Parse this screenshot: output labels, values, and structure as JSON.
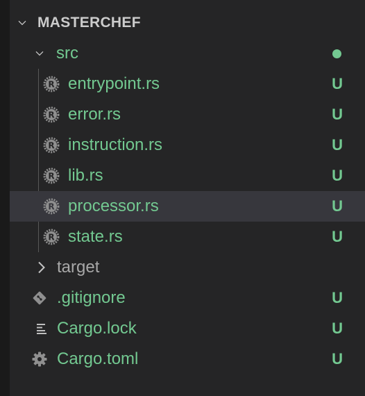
{
  "explorer": {
    "root": {
      "label": "MASTERCHEF",
      "icon": "chevron-down-icon"
    },
    "src_folder": {
      "label": "src",
      "icon": "chevron-down-icon",
      "status_indicator": "modified-dot",
      "status_color": "#73c991"
    },
    "src_files": [
      {
        "label": "entrypoint.rs",
        "status": "U",
        "icon": "rust-icon"
      },
      {
        "label": "error.rs",
        "status": "U",
        "icon": "rust-icon"
      },
      {
        "label": "instruction.rs",
        "status": "U",
        "icon": "rust-icon"
      },
      {
        "label": "lib.rs",
        "status": "U",
        "icon": "rust-icon"
      },
      {
        "label": "processor.rs",
        "status": "U",
        "icon": "rust-icon",
        "selected": true
      },
      {
        "label": "state.rs",
        "status": "U",
        "icon": "rust-icon"
      }
    ],
    "target_folder": {
      "label": "target",
      "icon": "chevron-right-icon"
    },
    "root_files": [
      {
        "label": ".gitignore",
        "status": "U",
        "icon": "git-icon"
      },
      {
        "label": "Cargo.lock",
        "status": "U",
        "icon": "lines-icon"
      },
      {
        "label": "Cargo.toml",
        "status": "U",
        "icon": "gear-icon"
      }
    ]
  },
  "colors": {
    "untracked": "#73c991",
    "ignored": "#a8a8a8",
    "background": "#252526",
    "selected_row": "#37373d"
  }
}
